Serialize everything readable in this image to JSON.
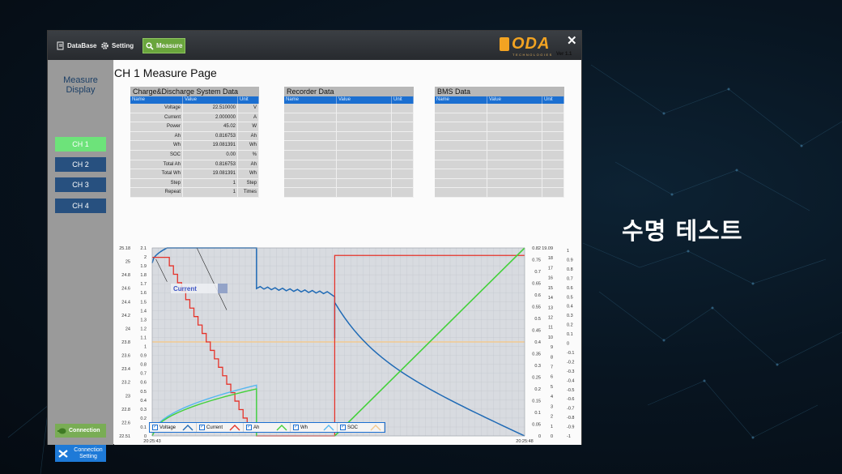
{
  "caption": "수명 테스트",
  "menu": {
    "database": "DataBase",
    "setting": "Setting",
    "measure": "Measure"
  },
  "brand": {
    "logo": "ODA",
    "sub": "TECHNOLOGIES",
    "version": "Ver 1.1"
  },
  "sidebar": {
    "title_line1": "Measure",
    "title_line2": "Display",
    "channels": [
      "CH 1",
      "CH 2",
      "CH 3",
      "CH 4"
    ],
    "connection": "Connection",
    "connection_setting_line1": "Connection",
    "connection_setting_line2": "Setting"
  },
  "page_title": "CH 1 Measure Page",
  "tables": {
    "charge": {
      "title": "Charge&Discharge System Data",
      "headers": [
        "Name",
        "Value",
        "Unit"
      ],
      "rows": [
        [
          "Voltage",
          "22.510000",
          "V"
        ],
        [
          "Current",
          "2.000000",
          "A"
        ],
        [
          "Power",
          "45.02",
          "W"
        ],
        [
          "Ah",
          "0.816753",
          "Ah"
        ],
        [
          "Wh",
          "19.081391",
          "Wh"
        ],
        [
          "SOC",
          "0.00",
          "%"
        ],
        [
          "Total Ah",
          "0.816753",
          "Ah"
        ],
        [
          "Total Wh",
          "19.081391",
          "Wh"
        ],
        [
          "Step",
          "1",
          "Step"
        ],
        [
          "Repeat",
          "1",
          "Times"
        ]
      ]
    },
    "recorder": {
      "title": "Recorder Data",
      "headers": [
        "Name",
        "Value",
        "Unit"
      ]
    },
    "bms": {
      "title": "BMS Data",
      "headers": [
        "Name",
        "Value",
        "Unit"
      ]
    }
  },
  "chart_data": {
    "type": "line",
    "x_start": "20:25:43",
    "x_end": "20:25:48",
    "annotation": "Current",
    "y_axes": {
      "voltage": [
        "25.18",
        "25",
        "24.8",
        "24.6",
        "24.4",
        "24.2",
        "24",
        "23.8",
        "23.6",
        "23.4",
        "23.2",
        "23",
        "22.8",
        "22.6",
        "22.51"
      ],
      "current": [
        "2.1",
        "2",
        "1.9",
        "1.8",
        "1.7",
        "1.6",
        "1.5",
        "1.4",
        "1.3",
        "1.2",
        "1.1",
        "1",
        "0.9",
        "0.8",
        "0.7",
        "0.6",
        "0.5",
        "0.4",
        "0.3",
        "0.2",
        "0.1",
        "0"
      ],
      "ah": [
        "0.82",
        "0.75",
        "0.7",
        "0.65",
        "0.6",
        "0.55",
        "0.5",
        "0.45",
        "0.4",
        "0.35",
        "0.3",
        "0.25",
        "0.2",
        "0.15",
        "0.1",
        "0.05",
        "0"
      ],
      "wh": [
        "19.09",
        "18",
        "17",
        "16",
        "15",
        "14",
        "13",
        "12",
        "11",
        "10",
        "9",
        "8",
        "7",
        "6",
        "5",
        "4",
        "3",
        "2",
        "1",
        "0"
      ],
      "soc": [
        "1",
        "0.9",
        "0.8",
        "0.7",
        "0.6",
        "0.5",
        "0.4",
        "0.3",
        "0.2",
        "0.1",
        "0",
        "-0.1",
        "-0.2",
        "-0.3",
        "-0.4",
        "-0.5",
        "-0.6",
        "-0.7",
        "-0.8",
        "-0.9",
        "-1"
      ]
    },
    "series": [
      {
        "name": "Voltage",
        "color": "#1f6ab5"
      },
      {
        "name": "Current",
        "color": "#e5332a"
      },
      {
        "name": "Ah",
        "color": "#43d13a"
      },
      {
        "name": "Wh",
        "color": "#55b7f0"
      },
      {
        "name": "SOC",
        "color": "#f3c98f"
      }
    ]
  }
}
